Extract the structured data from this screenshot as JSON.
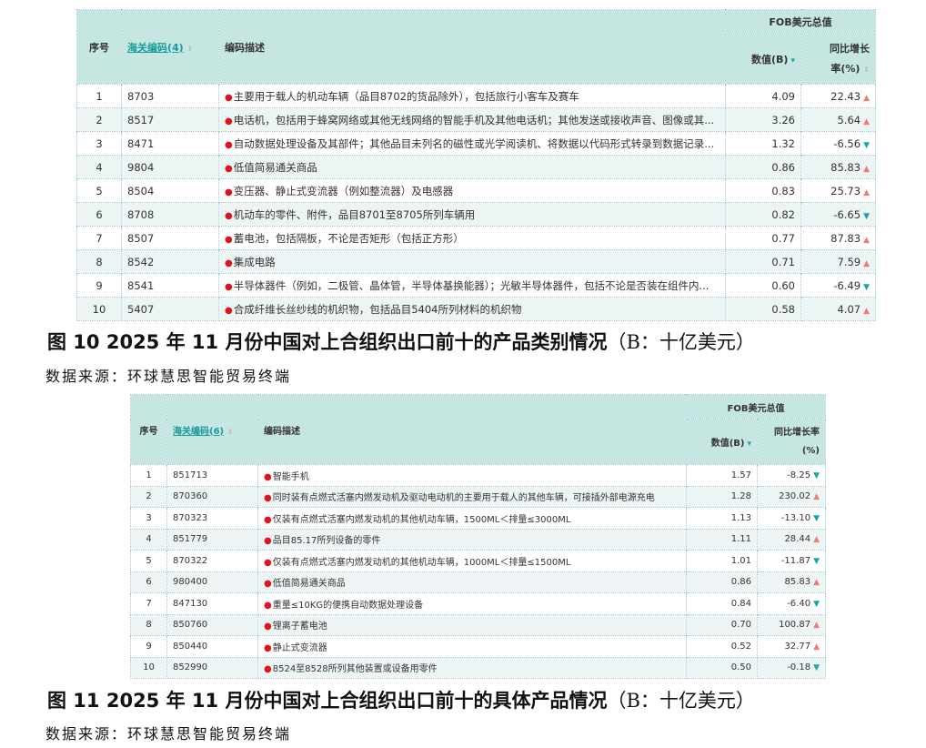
{
  "colors": {
    "header_bg": "#c6e6e1",
    "alt_row": "#edf4f4",
    "link": "#1a9b9b",
    "up": "#ee7a7a",
    "down": "#1aa7a0",
    "bullet": "#e0141e"
  },
  "table1": {
    "headers": {
      "index": "序号",
      "code": "海关编码(4)",
      "desc": "编码描述",
      "fob": "FOB美元总值",
      "value": "数值(B)",
      "growth_a": "同比增长",
      "growth_b": "率(%)"
    },
    "rows": [
      {
        "i": "1",
        "code": "8703",
        "desc": "主要用于载人的机动车辆（品目8702的货品除外），包括旅行小客车及赛车",
        "value": "4.09",
        "growth": "22.43",
        "dir": "up"
      },
      {
        "i": "2",
        "code": "8517",
        "desc": "电话机，包括用于蜂窝网络或其他无线网络的智能手机及其他电话机；其他发送或接收声音、图像或其...",
        "value": "3.26",
        "growth": "5.64",
        "dir": "up"
      },
      {
        "i": "3",
        "code": "8471",
        "desc": "自动数据处理设备及其部件；其他品目未列名的磁性或光学阅读机、将数据以代码形式转录到数据记录...",
        "value": "1.32",
        "growth": "-6.56",
        "dir": "down"
      },
      {
        "i": "4",
        "code": "9804",
        "desc": "低值简易通关商品",
        "value": "0.86",
        "growth": "85.83",
        "dir": "up"
      },
      {
        "i": "5",
        "code": "8504",
        "desc": "变压器、静止式变流器（例如整流器）及电感器",
        "value": "0.83",
        "growth": "25.73",
        "dir": "up"
      },
      {
        "i": "6",
        "code": "8708",
        "desc": "机动车的零件、附件，品目8701至8705所列车辆用",
        "value": "0.82",
        "growth": "-6.65",
        "dir": "down"
      },
      {
        "i": "7",
        "code": "8507",
        "desc": "蓄电池，包括隔板，不论是否矩形（包括正方形）",
        "value": "0.77",
        "growth": "87.83",
        "dir": "up"
      },
      {
        "i": "8",
        "code": "8542",
        "desc": "集成电路",
        "value": "0.71",
        "growth": "7.59",
        "dir": "up"
      },
      {
        "i": "9",
        "code": "8541",
        "desc": "半导体器件（例如，二极管、晶体管，半导体基换能器）；光敏半导体器件，包括不论是否装在组件内...",
        "value": "0.60",
        "growth": "-6.49",
        "dir": "down"
      },
      {
        "i": "10",
        "code": "5407",
        "desc": "合成纤维长丝纱线的机织物，包括品目5404所列材料的机织物",
        "value": "0.58",
        "growth": "4.07",
        "dir": "up"
      }
    ]
  },
  "caption1": {
    "title": "图 10  2025 年 11 月份中国对上合组织出口前十的产品类别情况",
    "unit": "（B：十亿美元）"
  },
  "source1": "数据来源：环球慧思智能贸易终端",
  "table2": {
    "headers": {
      "index": "序号",
      "code": "海关编码(6)",
      "desc": "编码描述",
      "fob": "FOB美元总值",
      "value": "数值(B)",
      "growth_a": "同比增长率",
      "growth_b": "(%)"
    },
    "rows": [
      {
        "i": "1",
        "code": "851713",
        "desc": "智能手机",
        "value": "1.57",
        "growth": "-8.25",
        "dir": "down"
      },
      {
        "i": "2",
        "code": "870360",
        "desc": "同时装有点燃式活塞内燃发动机及驱动电动机的主要用于载人的其他车辆，可接插外部电源充电",
        "value": "1.28",
        "growth": "230.02",
        "dir": "up"
      },
      {
        "i": "3",
        "code": "870323",
        "desc": "仅装有点燃式活塞内燃发动机的其他机动车辆，1500ML＜排量≤3000ML",
        "value": "1.13",
        "growth": "-13.10",
        "dir": "down"
      },
      {
        "i": "4",
        "code": "851779",
        "desc": "品目85.17所列设备的零件",
        "value": "1.11",
        "growth": "28.44",
        "dir": "up"
      },
      {
        "i": "5",
        "code": "870322",
        "desc": "仅装有点燃式活塞内燃发动机的其他机动车辆，1000ML＜排量≤1500ML",
        "value": "1.01",
        "growth": "-11.87",
        "dir": "down"
      },
      {
        "i": "6",
        "code": "980400",
        "desc": "低值简易通关商品",
        "value": "0.86",
        "growth": "85.83",
        "dir": "up"
      },
      {
        "i": "7",
        "code": "847130",
        "desc": "重量≤10KG的便携自动数据处理设备",
        "value": "0.84",
        "growth": "-6.40",
        "dir": "down"
      },
      {
        "i": "8",
        "code": "850760",
        "desc": "锂离子蓄电池",
        "value": "0.70",
        "growth": "100.87",
        "dir": "up"
      },
      {
        "i": "9",
        "code": "850440",
        "desc": "静止式变流器",
        "value": "0.52",
        "growth": "32.77",
        "dir": "up"
      },
      {
        "i": "10",
        "code": "852990",
        "desc": "8524至8528所列其他装置或设备用零件",
        "value": "0.50",
        "growth": "-0.18",
        "dir": "down"
      }
    ]
  },
  "caption2": {
    "title": "图 11  2025 年 11 月份中国对上合组织出口前十的具体产品情况",
    "unit": "（B：十亿美元）"
  },
  "source2": "数据来源：环球慧思智能贸易终端"
}
